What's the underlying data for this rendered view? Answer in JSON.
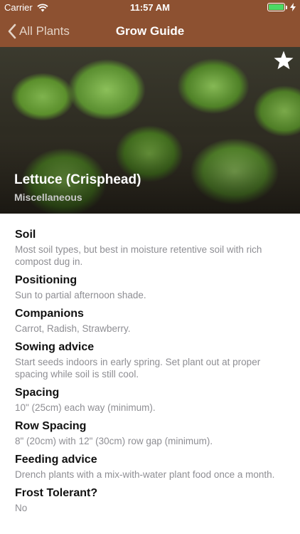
{
  "status_bar": {
    "carrier": "Carrier",
    "time": "11:57 AM",
    "battery_level": 1.0
  },
  "nav": {
    "back_label": "All Plants",
    "title": "Grow Guide"
  },
  "plant": {
    "name": "Lettuce (Crisphead)",
    "category": "Miscellaneous"
  },
  "sections": [
    {
      "heading": "Soil",
      "text": "Most soil types, but best in moisture retentive soil with rich compost dug in."
    },
    {
      "heading": "Positioning",
      "text": "Sun to partial afternoon shade."
    },
    {
      "heading": "Companions",
      "text": "Carrot, Radish, Strawberry."
    },
    {
      "heading": "Sowing advice",
      "text": "Start seeds indoors in early spring. Set plant out at proper spacing while soil is still cool."
    },
    {
      "heading": "Spacing",
      "text": "10\" (25cm) each way (minimum)."
    },
    {
      "heading": "Row Spacing",
      "text": "8\" (20cm) with 12\" (30cm) row gap (minimum)."
    },
    {
      "heading": "Feeding advice",
      "text": "Drench plants with a mix-with-water plant food once a month."
    },
    {
      "heading": "Frost Tolerant?",
      "text": "No"
    }
  ],
  "colors": {
    "nav_background": "#8d5131",
    "battery": "#4cd964"
  },
  "icons": {
    "back": "chevron-left-icon",
    "favorite": "star-icon",
    "wifi": "wifi-icon",
    "charging": "bolt-icon"
  }
}
